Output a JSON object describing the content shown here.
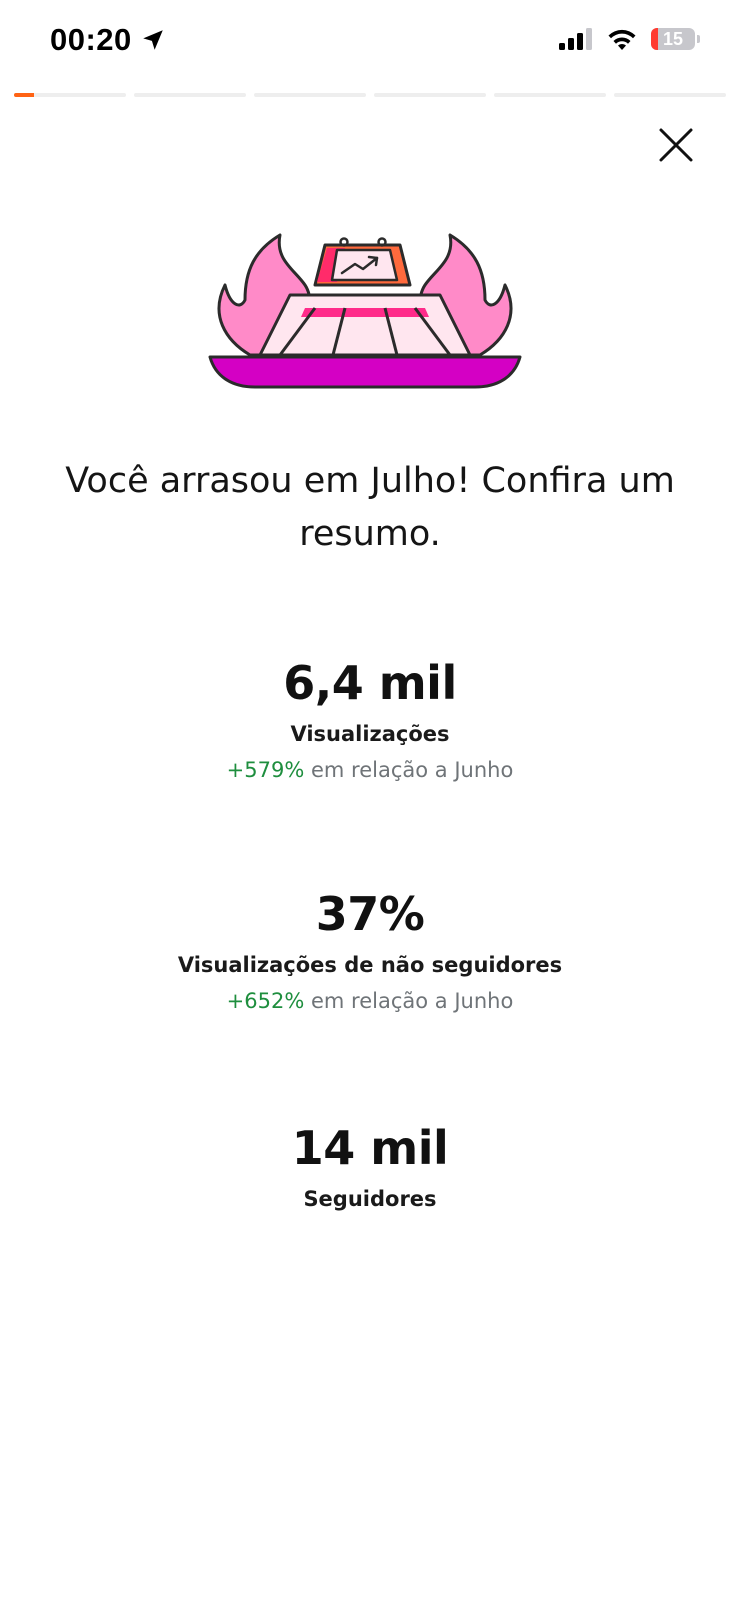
{
  "status_bar": {
    "time": "00:20",
    "battery": "15",
    "battery_level": 0.15,
    "icons": [
      "location-arrow-icon",
      "cellular-signal-icon",
      "wifi-icon",
      "battery-icon"
    ]
  },
  "story_progress": {
    "segments": 6,
    "active_index": 0,
    "active_progress": 0.18,
    "accent_color": "#ff6314"
  },
  "close_icon": "close-icon",
  "illustration": "flaming-stage-trophy-illustration",
  "headline": "Você arrasou em Julho! Confira um resumo.",
  "stats": [
    {
      "value": "6,4 mil",
      "label": "Visualizações",
      "delta": "+579%",
      "comparison": "em relação a Junho"
    },
    {
      "value": "37%",
      "label": "Visualizações de não seguidores",
      "delta": "+652%",
      "comparison": "em relação a Junho"
    },
    {
      "value": "14 mil",
      "label": "Seguidores"
    }
  ],
  "colors": {
    "delta_positive": "#1e8e3e",
    "muted_text": "#6f7478",
    "flame_pink": "#ff8ac8",
    "base_magenta": "#d400c4"
  }
}
